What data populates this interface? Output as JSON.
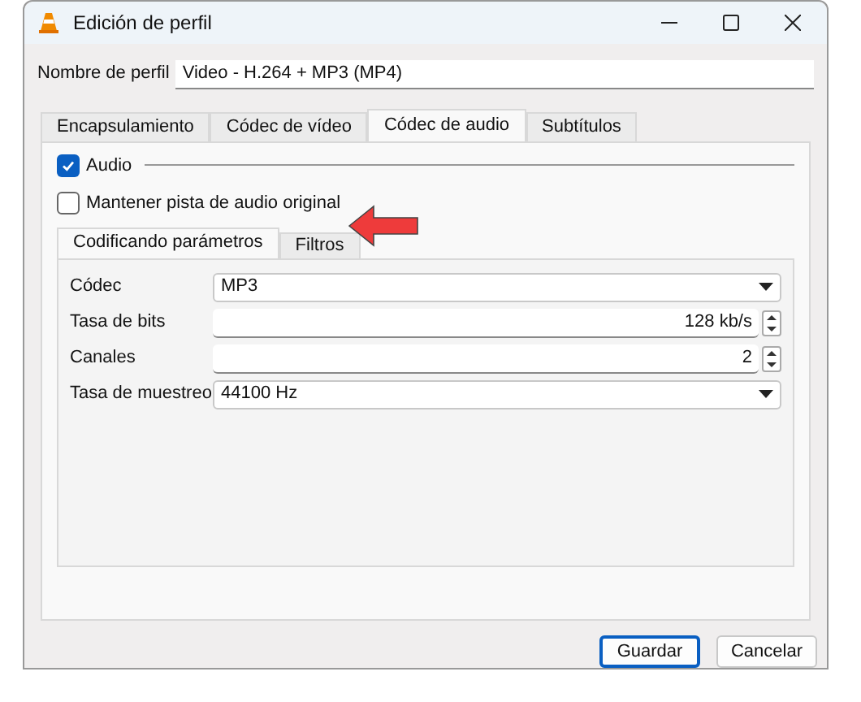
{
  "window": {
    "title": "Edición de perfil"
  },
  "profile_name": {
    "label": "Nombre de perfil",
    "value": "Video - H.264 + MP3 (MP4)"
  },
  "tabs": [
    {
      "label": "Encapsulamiento",
      "selected": false
    },
    {
      "label": "Códec de vídeo",
      "selected": false
    },
    {
      "label": "Códec de audio",
      "selected": true
    },
    {
      "label": "Subtítulos",
      "selected": false
    }
  ],
  "audio": {
    "label": "Audio",
    "checked": true
  },
  "keep_original": {
    "label": "Mantener pista de audio original",
    "checked": false
  },
  "inner_tabs": [
    {
      "label": "Codificando parámetros",
      "selected": true
    },
    {
      "label": "Filtros",
      "selected": false
    }
  ],
  "fields": [
    {
      "kind": "dropdown",
      "label": "Códec",
      "value": "MP3"
    },
    {
      "kind": "spin",
      "label": "Tasa de bits",
      "value": "128 kb/s"
    },
    {
      "kind": "spin",
      "label": "Canales",
      "value": "2"
    },
    {
      "kind": "dropdown",
      "label": "Tasa de muestreo",
      "value": "44100 Hz"
    }
  ],
  "buttons": [
    {
      "label": "Guardar",
      "default": true
    },
    {
      "label": "Cancelar",
      "default": false
    }
  ]
}
